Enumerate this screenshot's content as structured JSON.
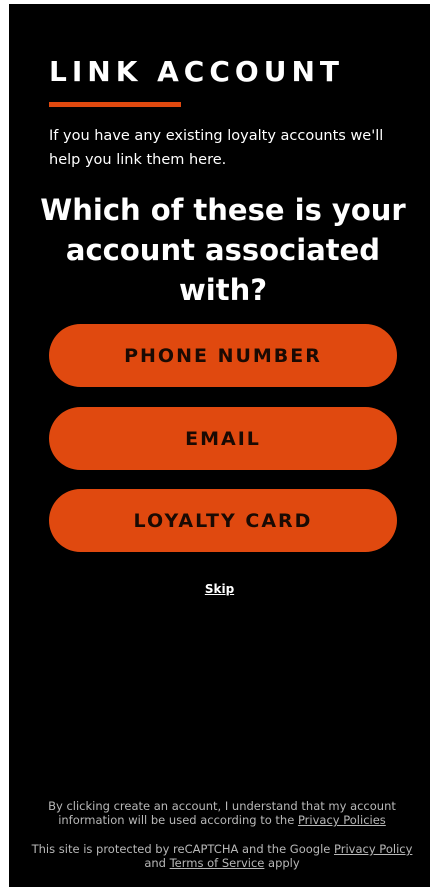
{
  "header": {
    "title": "LINK ACCOUNT",
    "accent_color": "#e0490f"
  },
  "intro": {
    "text": "If you have any existing loyalty accounts we'll help you link them here."
  },
  "question": {
    "text": "Which of these is your account associated with?"
  },
  "options": [
    {
      "label": "PHONE NUMBER"
    },
    {
      "label": "EMAIL"
    },
    {
      "label": "LOYALTY CARD"
    }
  ],
  "skip": {
    "label": "Skip"
  },
  "footer": {
    "consent_text": "By clicking create an account, I understand that my account information will be used according to the",
    "privacy_policies_link": "Privacy Policies",
    "recaptcha_text": "This site is protected by reCAPTCHA and the Google",
    "privacy_policy_link": "Privacy Policy",
    "and_text": "and",
    "terms_link": "Terms of Service",
    "apply_text": "apply"
  },
  "colors": {
    "background": "#000000",
    "button": "#e0490f",
    "button_text": "#1a0a03",
    "footer_text": "#b8b8b8"
  }
}
